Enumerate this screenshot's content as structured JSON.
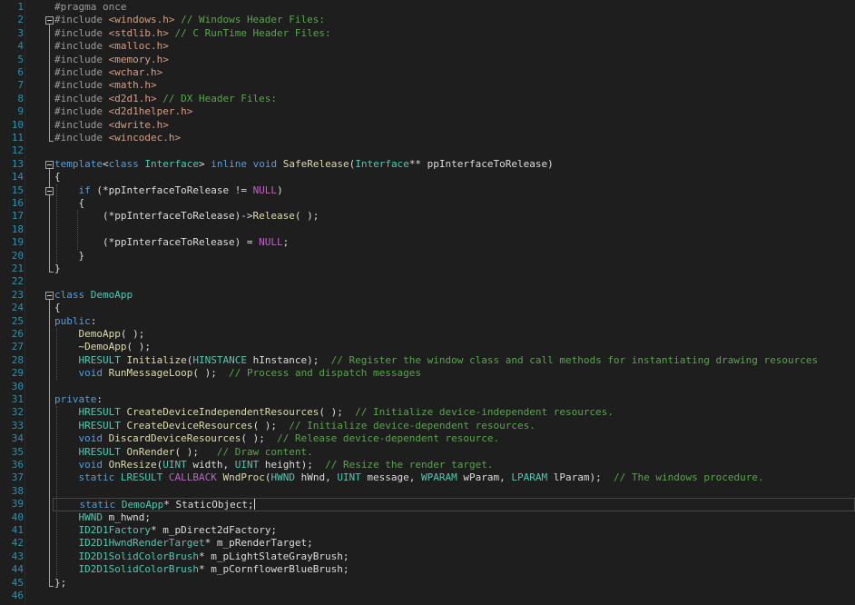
{
  "editor": {
    "current_line": 39,
    "lines": [
      {
        "n": "1",
        "tokens": [
          {
            "t": "#pragma once",
            "c": "pre"
          }
        ]
      },
      {
        "n": "2",
        "tokens": [
          {
            "t": "#include ",
            "c": "pre"
          },
          {
            "t": "<windows.h>",
            "c": "str"
          },
          {
            "t": " // Windows Header Files:",
            "c": "com"
          }
        ]
      },
      {
        "n": "3",
        "tokens": [
          {
            "t": "#include ",
            "c": "pre"
          },
          {
            "t": "<stdlib.h>",
            "c": "str"
          },
          {
            "t": " // C RunTime Header Files:",
            "c": "com"
          }
        ]
      },
      {
        "n": "4",
        "tokens": [
          {
            "t": "#include ",
            "c": "pre"
          },
          {
            "t": "<malloc.h>",
            "c": "str"
          }
        ]
      },
      {
        "n": "5",
        "tokens": [
          {
            "t": "#include ",
            "c": "pre"
          },
          {
            "t": "<memory.h>",
            "c": "str"
          }
        ]
      },
      {
        "n": "6",
        "tokens": [
          {
            "t": "#include ",
            "c": "pre"
          },
          {
            "t": "<wchar.h>",
            "c": "str"
          }
        ]
      },
      {
        "n": "7",
        "tokens": [
          {
            "t": "#include ",
            "c": "pre"
          },
          {
            "t": "<math.h>",
            "c": "str"
          }
        ]
      },
      {
        "n": "8",
        "tokens": [
          {
            "t": "#include ",
            "c": "pre"
          },
          {
            "t": "<d2d1.h>",
            "c": "str"
          },
          {
            "t": " // DX Header Files:",
            "c": "com"
          }
        ]
      },
      {
        "n": "9",
        "tokens": [
          {
            "t": "#include ",
            "c": "pre"
          },
          {
            "t": "<d2d1helper.h>",
            "c": "str"
          }
        ]
      },
      {
        "n": "10",
        "tokens": [
          {
            "t": "#include ",
            "c": "pre"
          },
          {
            "t": "<dwrite.h>",
            "c": "str"
          }
        ]
      },
      {
        "n": "11",
        "tokens": [
          {
            "t": "#include ",
            "c": "pre"
          },
          {
            "t": "<wincodec.h>",
            "c": "str"
          }
        ]
      },
      {
        "n": "12",
        "tokens": []
      },
      {
        "n": "13",
        "tokens": [
          {
            "t": "template",
            "c": "kw"
          },
          {
            "t": "<",
            "c": "plain"
          },
          {
            "t": "class",
            "c": "kw"
          },
          {
            "t": " ",
            "c": "plain"
          },
          {
            "t": "Interface",
            "c": "type"
          },
          {
            "t": "> ",
            "c": "plain"
          },
          {
            "t": "inline",
            "c": "kw"
          },
          {
            "t": " ",
            "c": "plain"
          },
          {
            "t": "void",
            "c": "kw"
          },
          {
            "t": " ",
            "c": "plain"
          },
          {
            "t": "SafeRelease",
            "c": "func"
          },
          {
            "t": "(",
            "c": "plain"
          },
          {
            "t": "Interface",
            "c": "type"
          },
          {
            "t": "** ppInterfaceToRelease)",
            "c": "plain"
          }
        ]
      },
      {
        "n": "14",
        "tokens": [
          {
            "t": "{",
            "c": "plain"
          }
        ]
      },
      {
        "n": "15",
        "tokens": [
          {
            "t": "    ",
            "c": "plain"
          },
          {
            "t": "if",
            "c": "kw"
          },
          {
            "t": " (*ppInterfaceToRelease != ",
            "c": "plain"
          },
          {
            "t": "NULL",
            "c": "macro"
          },
          {
            "t": ")",
            "c": "plain"
          }
        ]
      },
      {
        "n": "16",
        "tokens": [
          {
            "t": "    {",
            "c": "plain"
          }
        ]
      },
      {
        "n": "17",
        "tokens": [
          {
            "t": "        (*ppInterfaceToRelease)->",
            "c": "plain"
          },
          {
            "t": "Release",
            "c": "func"
          },
          {
            "t": "( );",
            "c": "plain"
          }
        ]
      },
      {
        "n": "18",
        "tokens": []
      },
      {
        "n": "19",
        "tokens": [
          {
            "t": "        (*ppInterfaceToRelease) = ",
            "c": "plain"
          },
          {
            "t": "NULL",
            "c": "macro"
          },
          {
            "t": ";",
            "c": "plain"
          }
        ]
      },
      {
        "n": "20",
        "tokens": [
          {
            "t": "    }",
            "c": "plain"
          }
        ]
      },
      {
        "n": "21",
        "tokens": [
          {
            "t": "}",
            "c": "plain"
          }
        ]
      },
      {
        "n": "22",
        "tokens": []
      },
      {
        "n": "23",
        "tokens": [
          {
            "t": "class",
            "c": "kw"
          },
          {
            "t": " ",
            "c": "plain"
          },
          {
            "t": "DemoApp",
            "c": "type"
          }
        ]
      },
      {
        "n": "24",
        "tokens": [
          {
            "t": "{",
            "c": "plain"
          }
        ]
      },
      {
        "n": "25",
        "tokens": [
          {
            "t": "public",
            "c": "kw"
          },
          {
            "t": ":",
            "c": "plain"
          }
        ]
      },
      {
        "n": "26",
        "tokens": [
          {
            "t": "    ",
            "c": "plain"
          },
          {
            "t": "DemoApp",
            "c": "func"
          },
          {
            "t": "( );",
            "c": "plain"
          }
        ]
      },
      {
        "n": "27",
        "tokens": [
          {
            "t": "    ~",
            "c": "plain"
          },
          {
            "t": "DemoApp",
            "c": "func"
          },
          {
            "t": "( );",
            "c": "plain"
          }
        ]
      },
      {
        "n": "28",
        "tokens": [
          {
            "t": "    ",
            "c": "plain"
          },
          {
            "t": "HRESULT",
            "c": "type"
          },
          {
            "t": " ",
            "c": "plain"
          },
          {
            "t": "Initialize",
            "c": "func"
          },
          {
            "t": "(",
            "c": "plain"
          },
          {
            "t": "HINSTANCE",
            "c": "type"
          },
          {
            "t": " hInstance);  ",
            "c": "plain"
          },
          {
            "t": "// Register the window class and call methods for instantiating drawing resources",
            "c": "com"
          }
        ]
      },
      {
        "n": "29",
        "tokens": [
          {
            "t": "    ",
            "c": "plain"
          },
          {
            "t": "void",
            "c": "kw"
          },
          {
            "t": " ",
            "c": "plain"
          },
          {
            "t": "RunMessageLoop",
            "c": "func"
          },
          {
            "t": "( );  ",
            "c": "plain"
          },
          {
            "t": "// Process and dispatch messages",
            "c": "com"
          }
        ]
      },
      {
        "n": "30",
        "tokens": []
      },
      {
        "n": "31",
        "tokens": [
          {
            "t": "private",
            "c": "kw"
          },
          {
            "t": ":",
            "c": "plain"
          }
        ]
      },
      {
        "n": "32",
        "tokens": [
          {
            "t": "    ",
            "c": "plain"
          },
          {
            "t": "HRESULT",
            "c": "type"
          },
          {
            "t": " ",
            "c": "plain"
          },
          {
            "t": "CreateDeviceIndependentResources",
            "c": "func"
          },
          {
            "t": "( );  ",
            "c": "plain"
          },
          {
            "t": "// Initialize device-independent resources.",
            "c": "com"
          }
        ]
      },
      {
        "n": "33",
        "tokens": [
          {
            "t": "    ",
            "c": "plain"
          },
          {
            "t": "HRESULT",
            "c": "type"
          },
          {
            "t": " ",
            "c": "plain"
          },
          {
            "t": "CreateDeviceResources",
            "c": "func"
          },
          {
            "t": "( );  ",
            "c": "plain"
          },
          {
            "t": "// Initialize device-dependent resources.",
            "c": "com"
          }
        ]
      },
      {
        "n": "34",
        "tokens": [
          {
            "t": "    ",
            "c": "plain"
          },
          {
            "t": "void",
            "c": "kw"
          },
          {
            "t": " ",
            "c": "plain"
          },
          {
            "t": "DiscardDeviceResources",
            "c": "func"
          },
          {
            "t": "( );  ",
            "c": "plain"
          },
          {
            "t": "// Release device-dependent resource.",
            "c": "com"
          }
        ]
      },
      {
        "n": "35",
        "tokens": [
          {
            "t": "    ",
            "c": "plain"
          },
          {
            "t": "HRESULT",
            "c": "type"
          },
          {
            "t": " ",
            "c": "plain"
          },
          {
            "t": "OnRender",
            "c": "func"
          },
          {
            "t": "( );   ",
            "c": "plain"
          },
          {
            "t": "// Draw content.",
            "c": "com"
          }
        ]
      },
      {
        "n": "36",
        "tokens": [
          {
            "t": "    ",
            "c": "plain"
          },
          {
            "t": "void",
            "c": "kw"
          },
          {
            "t": " ",
            "c": "plain"
          },
          {
            "t": "OnResize",
            "c": "func"
          },
          {
            "t": "(",
            "c": "plain"
          },
          {
            "t": "UINT",
            "c": "type"
          },
          {
            "t": " width, ",
            "c": "plain"
          },
          {
            "t": "UINT",
            "c": "type"
          },
          {
            "t": " height);  ",
            "c": "plain"
          },
          {
            "t": "// Resize the render target.",
            "c": "com"
          }
        ]
      },
      {
        "n": "37",
        "tokens": [
          {
            "t": "    ",
            "c": "plain"
          },
          {
            "t": "static",
            "c": "kw"
          },
          {
            "t": " ",
            "c": "plain"
          },
          {
            "t": "LRESULT",
            "c": "type"
          },
          {
            "t": " ",
            "c": "plain"
          },
          {
            "t": "CALLBACK",
            "c": "macro"
          },
          {
            "t": " ",
            "c": "plain"
          },
          {
            "t": "WndProc",
            "c": "func"
          },
          {
            "t": "(",
            "c": "plain"
          },
          {
            "t": "HWND",
            "c": "type"
          },
          {
            "t": " hWnd, ",
            "c": "plain"
          },
          {
            "t": "UINT",
            "c": "type"
          },
          {
            "t": " message, ",
            "c": "plain"
          },
          {
            "t": "WPARAM",
            "c": "type"
          },
          {
            "t": " wParam, ",
            "c": "plain"
          },
          {
            "t": "LPARAM",
            "c": "type"
          },
          {
            "t": " lParam);  ",
            "c": "plain"
          },
          {
            "t": "// The windows procedure.",
            "c": "com"
          }
        ]
      },
      {
        "n": "38",
        "tokens": []
      },
      {
        "n": "39",
        "tokens": [
          {
            "t": "    ",
            "c": "plain"
          },
          {
            "t": "static",
            "c": "kw"
          },
          {
            "t": " ",
            "c": "plain"
          },
          {
            "t": "DemoApp",
            "c": "type"
          },
          {
            "t": "* StaticObject;",
            "c": "plain"
          }
        ],
        "caret": true
      },
      {
        "n": "40",
        "tokens": [
          {
            "t": "    ",
            "c": "plain"
          },
          {
            "t": "HWND",
            "c": "type"
          },
          {
            "t": " m_hwnd;",
            "c": "plain"
          }
        ]
      },
      {
        "n": "41",
        "tokens": [
          {
            "t": "    ",
            "c": "plain"
          },
          {
            "t": "ID2D1Factory",
            "c": "type"
          },
          {
            "t": "* m_pDirect2dFactory;",
            "c": "plain"
          }
        ]
      },
      {
        "n": "42",
        "tokens": [
          {
            "t": "    ",
            "c": "plain"
          },
          {
            "t": "ID2D1HwndRenderTarget",
            "c": "type"
          },
          {
            "t": "* m_pRenderTarget;",
            "c": "plain"
          }
        ]
      },
      {
        "n": "43",
        "tokens": [
          {
            "t": "    ",
            "c": "plain"
          },
          {
            "t": "ID2D1SolidColorBrush",
            "c": "type"
          },
          {
            "t": "* m_pLightSlateGrayBrush;",
            "c": "plain"
          }
        ]
      },
      {
        "n": "44",
        "tokens": [
          {
            "t": "    ",
            "c": "plain"
          },
          {
            "t": "ID2D1SolidColorBrush",
            "c": "type"
          },
          {
            "t": "* m_pCornflowerBlueBrush;",
            "c": "plain"
          }
        ]
      },
      {
        "n": "45",
        "tokens": [
          {
            "t": "};",
            "c": "plain"
          }
        ]
      },
      {
        "n": "46",
        "tokens": []
      }
    ]
  }
}
